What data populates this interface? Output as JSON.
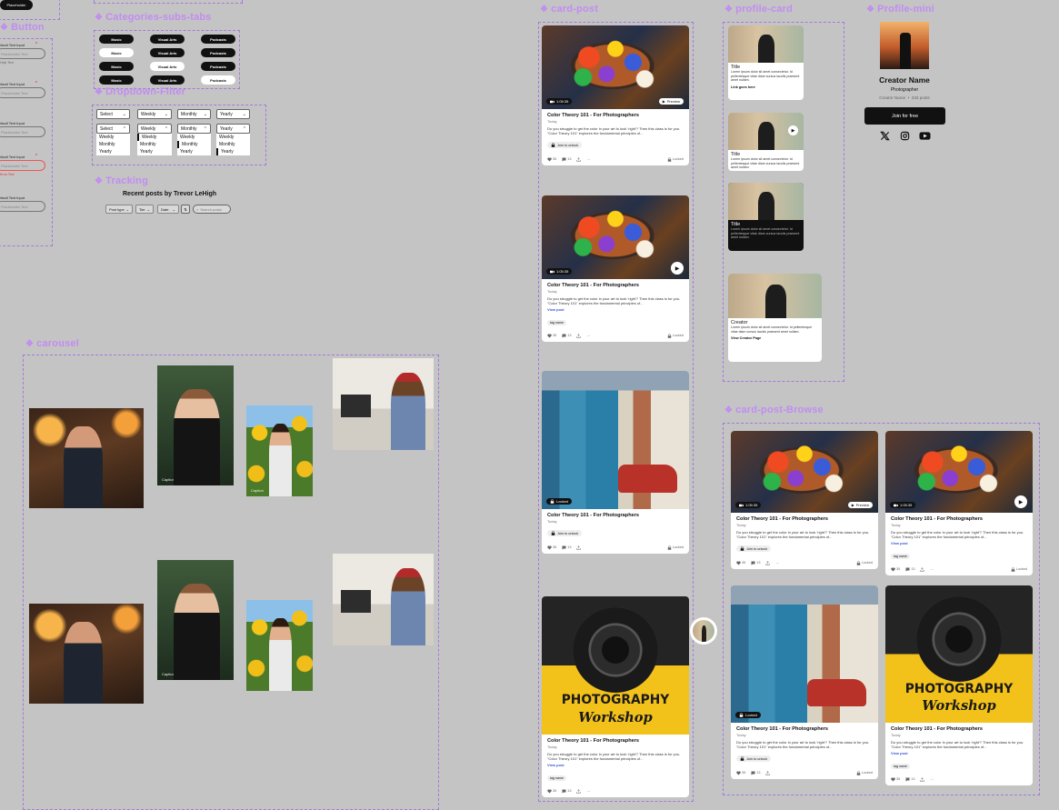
{
  "top_chip": "Placeholder",
  "frames": {
    "button": "Button",
    "categories": "Categories-subs-tabs",
    "dropdown": "Dropdown-Filter",
    "tracking": "Tracking",
    "carousel": "carousel",
    "card_post": "card-post",
    "profile_card": "profile-card",
    "profile_mini": "Profile-mini",
    "card_post_browse": "card-post-Browse"
  },
  "inputs": [
    {
      "label": "Default Text Input",
      "placeholder": "Placeholder Text",
      "helper": "Help Text",
      "required": true
    },
    {
      "label": "Default Text Input",
      "placeholder": "Placeholder Text",
      "helper": "",
      "required": true
    },
    {
      "label": "Default Text Input",
      "placeholder": "Placeholder Text",
      "helper": "",
      "required": false
    },
    {
      "label": "Default Text Input",
      "placeholder": "Placeholder Text",
      "helper": "Error Text",
      "required": true
    },
    {
      "label": "Default Text Input",
      "placeholder": "Placeholder Text",
      "helper": "",
      "required": false
    }
  ],
  "category_rows": [
    [
      {
        "label": "Music",
        "style": "dark"
      },
      {
        "label": "Visual Arts",
        "style": "dark"
      },
      {
        "label": "Podcasts",
        "style": "dark"
      }
    ],
    [
      {
        "label": "Music",
        "style": "light"
      },
      {
        "label": "Visual Arts",
        "style": "dark"
      },
      {
        "label": "Podcasts",
        "style": "dark"
      }
    ],
    [
      {
        "label": "Music",
        "style": "dark"
      },
      {
        "label": "Visual Arts",
        "style": "light"
      },
      {
        "label": "Podcasts",
        "style": "dark"
      }
    ],
    [
      {
        "label": "Music",
        "style": "dark"
      },
      {
        "label": "Visual Arts",
        "style": "dark"
      },
      {
        "label": "Podcasts",
        "style": "light"
      }
    ]
  ],
  "dropdowns": [
    {
      "value": "Select",
      "options": [
        "Weekly",
        "Monthly",
        "Yearly"
      ]
    },
    {
      "value": "Weekly",
      "options": [
        "Weekly",
        "Monthly",
        "Yearly"
      ]
    },
    {
      "value": "Monthly",
      "options": [
        "Weekly",
        "Monthly",
        "Yearly"
      ]
    },
    {
      "value": "Yearly",
      "options": [
        "Weekly",
        "Monthly",
        "Yearly"
      ]
    }
  ],
  "tracking": {
    "title": "Recent posts by Trevor LeHigh",
    "filters": [
      "Post type",
      "Tier",
      "Date"
    ],
    "search_placeholder": "Search posts"
  },
  "post_card": {
    "title": "Color Theory 101 - For Photographers",
    "date": "Today",
    "desc": "Do you struggle to get the color in your art to look 'right'? Then this class is for you. \"Color Theory 101\" explores the fundamental principles of...",
    "duration": "1:05:35",
    "preview": "Preview",
    "unlock": "Join to unlock",
    "view_post": "View post",
    "tag": "tag name",
    "locked": "Locked",
    "likes": "35",
    "comments": "13"
  },
  "workshop": {
    "line1": "PHOTOGRAPHY",
    "line2": "Workshop"
  },
  "profile_cards": [
    {
      "title": "Title",
      "desc": "Lorem ipsum dolor sit amet consectetur. Id pellentesque vitae diam cursus iaculis praesent amet nullam.",
      "link": "Link goes here"
    },
    {
      "title": "Title",
      "desc": "Lorem ipsum dolor sit amet consectetur. Id pellentesque vitae diam cursus iaculis praesent amet nullam.",
      "link": ""
    },
    {
      "title": "Title",
      "desc": "Lorem ipsum dolor sit amet consectetur. Id pellentesque vitae diam cursus iaculis praesent amet nullam.",
      "link": ""
    },
    {
      "title": "Creator",
      "desc": "Lorem ipsum dolor sit amet consectetur. Id pellentesque vitae diam cursus iaculis praesent amet nullam.",
      "link": "View Creator Page"
    }
  ],
  "profile_mini": {
    "name": "Creator Name",
    "role": "Photographer",
    "meta": "Creator Name  •  333 posts",
    "join": "Join for free"
  },
  "icons": [
    "x-icon",
    "instagram-icon",
    "youtube-icon",
    "lock-icon",
    "video-icon",
    "play-icon",
    "heart-icon",
    "comment-icon",
    "share-icon",
    "more-icon",
    "search-icon",
    "chevron-down-icon"
  ]
}
